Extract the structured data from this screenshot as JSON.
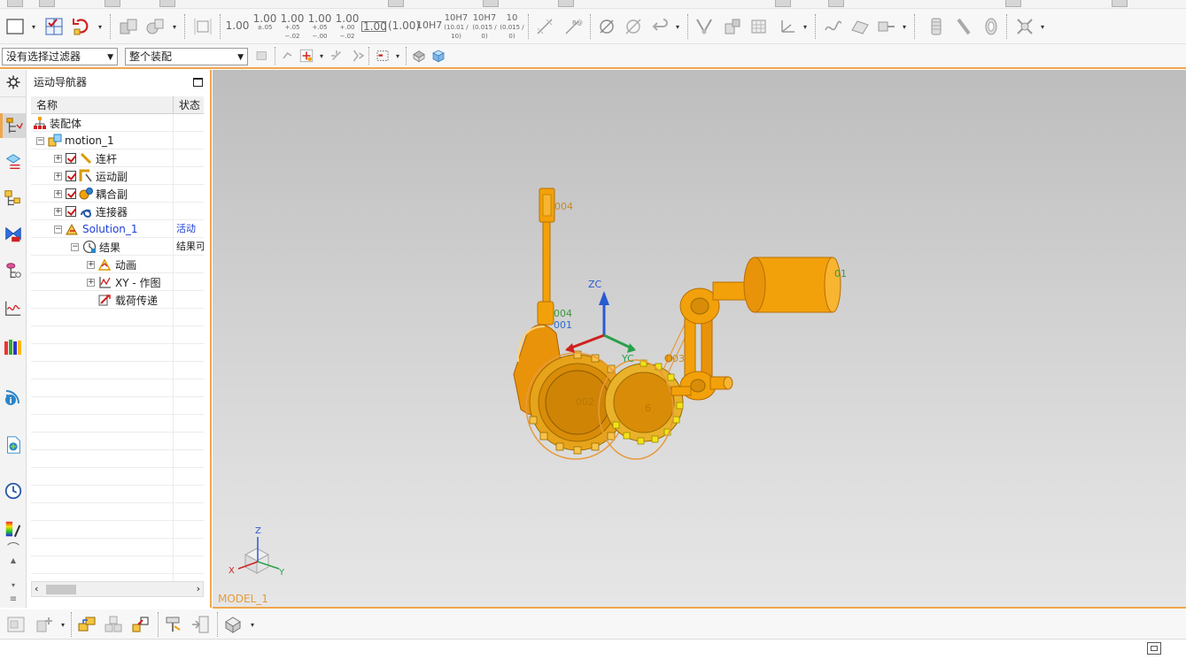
{
  "colors": {
    "accent_border": "#f0a64c",
    "model_orange": "#f2a10a",
    "model_label": "#e89a3c",
    "selection_text": "#1f3fd6"
  },
  "toolbar": {
    "tolerance_buttons": [
      {
        "main": "1.00",
        "sub": ""
      },
      {
        "main": "1.00",
        "sub": "±.05"
      },
      {
        "main": "1.00",
        "sub": "+.05 −.02"
      },
      {
        "main": "1.00",
        "sub": "+.05 −.00"
      },
      {
        "main": "1.00",
        "sub": "+.00 −.02"
      },
      {
        "main": "1.00",
        "sub": ""
      },
      {
        "main": "(1.00)",
        "sub": ""
      },
      {
        "main": "10H7",
        "sub": ""
      },
      {
        "main": "10H7",
        "sub": "(10.01 / 10)"
      },
      {
        "main": "10H7",
        "sub": "(0.015 / 0)"
      },
      {
        "main": "10",
        "sub": "(0.015 / 0)"
      }
    ]
  },
  "filter_bar": {
    "selection_filter": "没有选择过滤器",
    "scope": "整个装配"
  },
  "navigator": {
    "title": "运动导航器",
    "columns": [
      "名称",
      "状态"
    ],
    "rows": [
      {
        "label": "装配体",
        "status": ""
      },
      {
        "label": "motion_1",
        "status": ""
      },
      {
        "label": "连杆",
        "status": ""
      },
      {
        "label": "运动副",
        "status": ""
      },
      {
        "label": "耦合副",
        "status": ""
      },
      {
        "label": "连接器",
        "status": ""
      },
      {
        "label": "Solution_1",
        "status": "活动"
      },
      {
        "label": "结果",
        "status": "结果可"
      },
      {
        "label": "动画",
        "status": ""
      },
      {
        "label": "XY - 作图",
        "status": ""
      },
      {
        "label": "载荷传递",
        "status": ""
      }
    ]
  },
  "viewport": {
    "model_name": "MODEL_1",
    "axis_labels": {
      "zc": "ZC",
      "yc": "YC"
    },
    "triad_labels": {
      "z": "Z",
      "x": "X",
      "y": "Y"
    },
    "part_labels": {
      "top_slider": "004",
      "motor": "01",
      "pin_a": "004",
      "pin_b": "001",
      "gear_left": "002",
      "gear_right": "6",
      "belt": "003"
    }
  }
}
